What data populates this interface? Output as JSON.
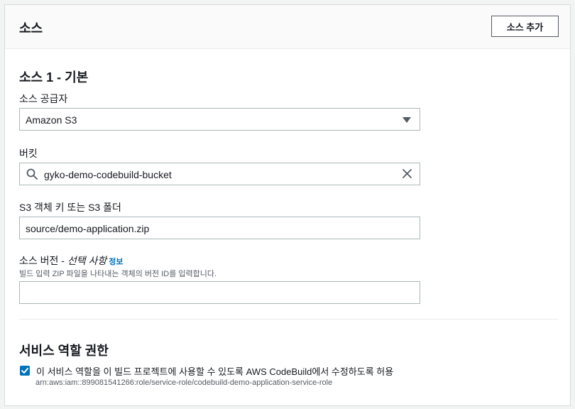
{
  "header": {
    "title": "소스",
    "add_button": "소스 추가"
  },
  "source": {
    "section_title": "소스 1 - 기본",
    "provider_label": "소스 공급자",
    "provider_value": "Amazon S3",
    "bucket_label": "버킷",
    "bucket_value": "gyko-demo-codebuild-bucket",
    "object_key_label": "S3 객체 키 또는 S3 폴더",
    "object_key_value": "source/demo-application.zip",
    "version_label": "소스 버전 - ",
    "version_optional": "선택 사항",
    "version_info": "정보",
    "version_description": "빌드 입력 ZIP 파일을 나타내는 객체의 버전 ID를 입력합니다.",
    "version_value": ""
  },
  "service_role": {
    "section_title": "서비스 역할 권한",
    "checkbox_label": "이 서비스 역할을 이 빌드 프로젝트에 사용할 수 있도록 AWS CodeBuild에서 수정하도록 허용",
    "checked": true,
    "role_arn": "arn:aws:iam::899081541266:role/service-role/codebuild-demo-application-service-role"
  },
  "colors": {
    "accent": "#0073bb",
    "border": "#aab7b8",
    "header_bg": "#fafafa",
    "text": "#16191f",
    "secondary_text": "#545b64"
  },
  "icons": [
    "caret-down-icon",
    "search-icon",
    "close-icon",
    "checkmark-icon"
  ]
}
